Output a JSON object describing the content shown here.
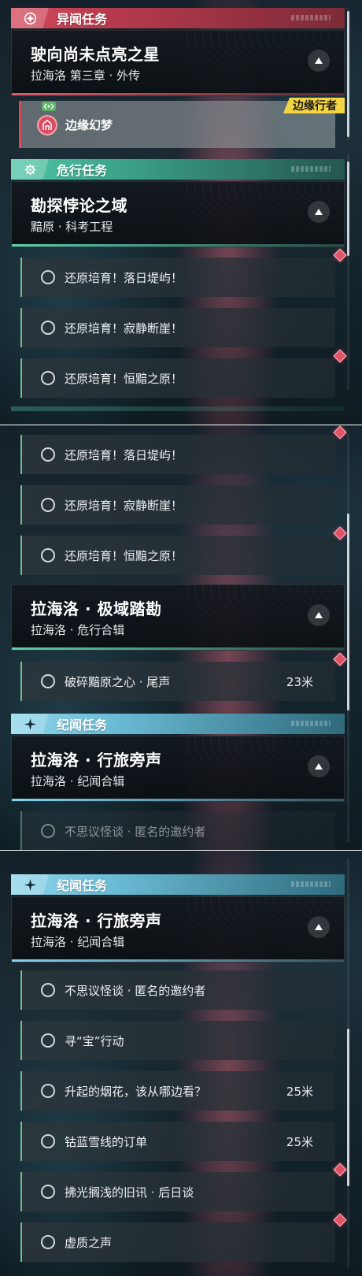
{
  "panel1": {
    "strange": {
      "category": "异闻任务",
      "title": "驶向尚未点亮之星",
      "subtitle": "拉海洛 第三章 · 外传",
      "side_quest": {
        "label": "边缘幻梦",
        "badge": "边缘行者"
      }
    },
    "danger": {
      "category": "危行任务",
      "title": "勘探悖论之域",
      "subtitle": "黯原 · 科考工程",
      "tasks": [
        "还原培育！落日堤屿！",
        "还原培育！寂静断崖！",
        "还原培育！恒黯之原！"
      ]
    }
  },
  "panel2": {
    "tasks": [
      "还原培育！落日堤屿！",
      "还原培育！寂静断崖！",
      "还原培育！恒黯之原！"
    ],
    "card": {
      "title": "拉海洛 · 极域踏勘",
      "subtitle": "拉海洛 · 危行合辑"
    },
    "card_task": {
      "label": "破碎黯原之心 · 尾声",
      "distance": "23米"
    },
    "chronicle": {
      "category": "纪闻任务",
      "title": "拉海洛 · 行旅旁声",
      "subtitle": "拉海洛 · 纪闻合辑",
      "task": "不思议怪谈 · 匿名的邀约者"
    }
  },
  "panel3": {
    "chronicle": {
      "category": "纪闻任务",
      "title": "拉海洛 · 行旅旁声",
      "subtitle": "拉海洛 · 纪闻合辑",
      "tasks": [
        {
          "label": "不思议怪谈 · 匿名的邀约者",
          "distance": ""
        },
        {
          "label": "寻“宝”行动",
          "distance": ""
        },
        {
          "label": "升起的烟花，该从哪边看？",
          "distance": "25米"
        },
        {
          "label": "钴蓝雪线的订单",
          "distance": "25米"
        },
        {
          "label": "拂光搁浅的旧讯 · 后日谈",
          "distance": ""
        },
        {
          "label": "虚质之声",
          "distance": ""
        }
      ]
    }
  },
  "colors": {
    "strange_accent": "#d44a5c",
    "danger_accent": "#52c6a6",
    "chronicle_accent": "#8fd6ea",
    "tracked_diamond": "#e05266",
    "badge_yellow": "#f3d443"
  },
  "icons": {
    "strange": "star-emblem-icon",
    "danger": "gear-hazard-icon",
    "chronicle": "sparkle-icon",
    "collapse": "triangle-up-icon",
    "task_status": "circle-outline-icon",
    "tracked": "diamond-marker-icon"
  }
}
